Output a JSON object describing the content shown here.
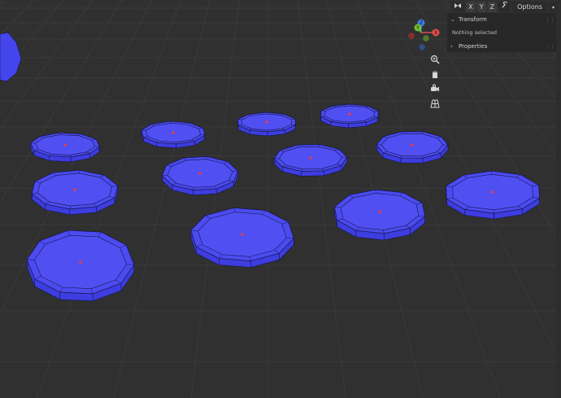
{
  "header": {
    "x_label": "X",
    "y_label": "Y",
    "z_label": "Z",
    "options_label": "Options"
  },
  "gizmo": {
    "z_label": "Z",
    "y_label": "Y",
    "x_label": "X"
  },
  "sidebar": {
    "transform": {
      "title": "Transform",
      "info": "Nothing selected"
    },
    "properties": {
      "title": "Properties"
    }
  },
  "colors": {
    "viewport_bg": "#303030",
    "grid_line": "#3a3a3a",
    "mesh_face": "#4b4bf0",
    "mesh_edge": "#16164a",
    "origin_dot": "#ff3a2a",
    "axis_x": "#e34b4b",
    "axis_y": "#71bf2f",
    "axis_z": "#3f7ee8"
  }
}
